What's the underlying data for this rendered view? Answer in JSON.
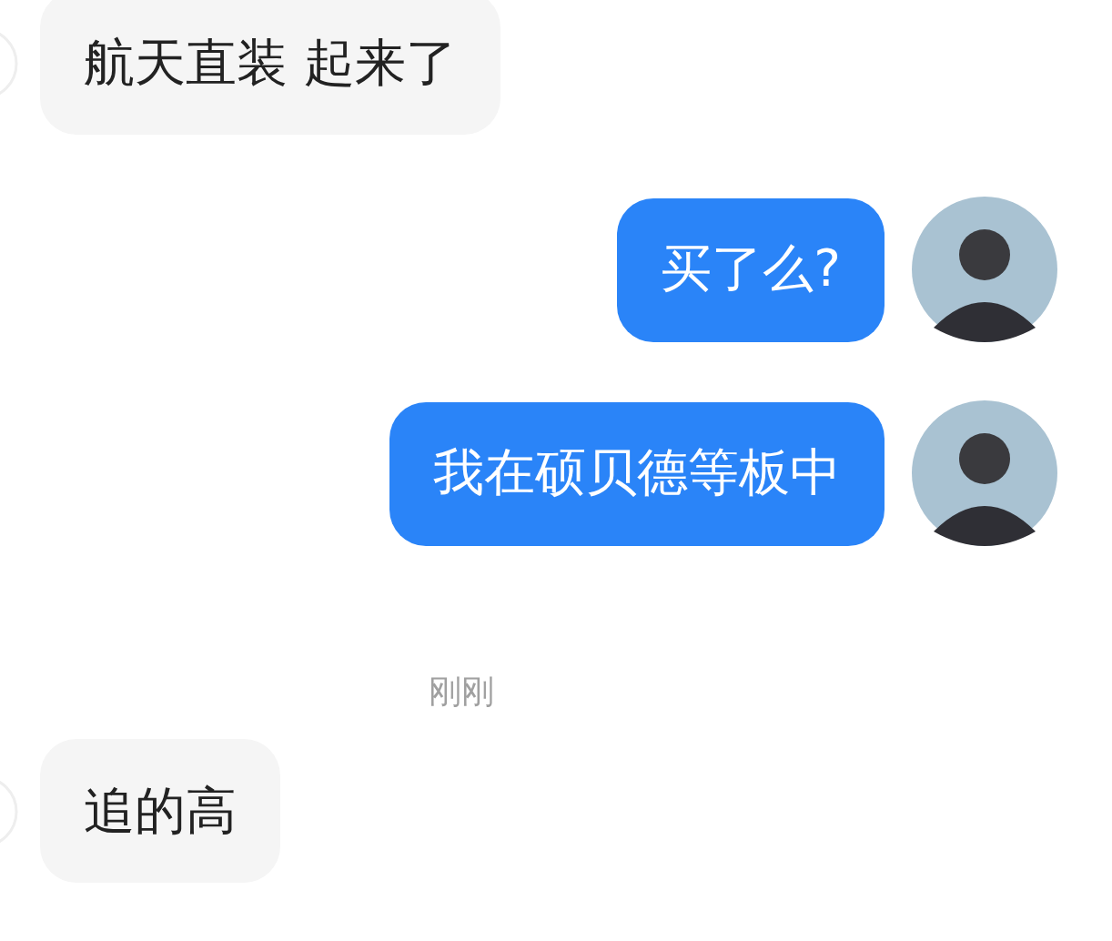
{
  "messages": [
    {
      "kind": "message",
      "outgoing": false,
      "text": "航天直装 起来了"
    },
    {
      "kind": "message",
      "outgoing": true,
      "text": "买了么?"
    },
    {
      "kind": "message",
      "outgoing": true,
      "text": "我在硕贝德等板中"
    },
    {
      "kind": "timestamp",
      "text": "刚刚"
    },
    {
      "kind": "message",
      "outgoing": false,
      "text": "追的高"
    }
  ]
}
